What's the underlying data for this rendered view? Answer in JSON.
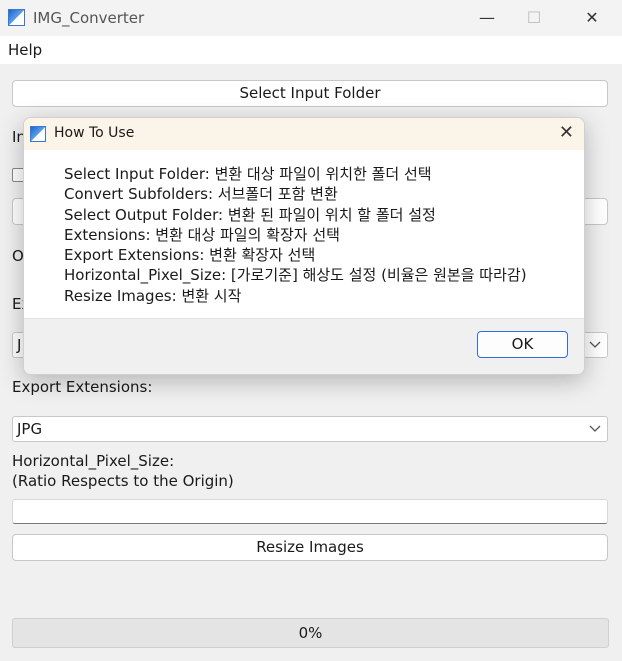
{
  "window": {
    "title": "IMG_Converter",
    "minimize": "—",
    "maximize": "☐",
    "close": "✕"
  },
  "menu": {
    "help": "Help"
  },
  "main": {
    "select_input_folder": "Select Input Folder",
    "input_label_partial": "In",
    "output_label_partial": "O",
    "extensions_label_partial": "Ex",
    "extensions_value_partial": "J",
    "export_extensions_label": "Export Extensions:",
    "export_extensions_value": "JPG",
    "horizontal_label": "Horizontal_Pixel_Size:",
    "ratio_label": "(Ratio Respects to the Origin)",
    "horizontal_input_value": "",
    "resize_button": "Resize Images",
    "progress_text": "0%",
    "progress_value": 0
  },
  "dialog": {
    "title": "How To Use",
    "close": "✕",
    "lines": [
      "Select Input Folder: 변환 대상 파일이 위치한 폴더 선택",
      "Convert Subfolders: 서브폴더 포함 변환",
      "Select Output Folder: 변환 된 파일이 위치 할 폴더 설정",
      "Extensions: 변환 대상 파일의 확장자 선택",
      "Export Extensions: 변환 확장자 선택",
      "Horizontal_Pixel_Size: [가로기준] 해상도 설정 (비율은 원본을 따라감)",
      "Resize Images: 변환 시작"
    ],
    "ok": "OK"
  },
  "icons": {
    "app": "app-icon",
    "chevron": "chevron-down-icon"
  },
  "colors": {
    "accent": "#2f6fd6",
    "dialog_titlebar": "#fbf4e8",
    "background": "#f0f0f0"
  }
}
